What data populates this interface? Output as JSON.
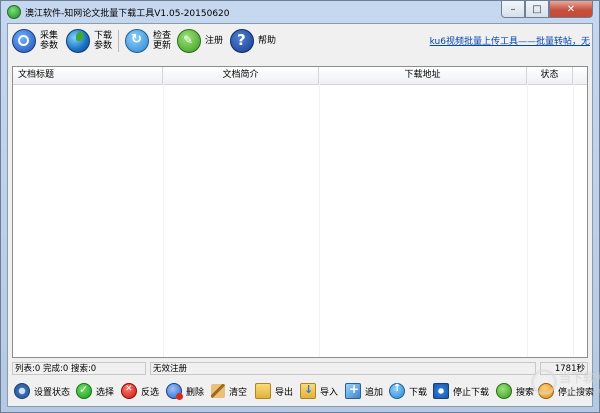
{
  "window": {
    "title": "澳江软件-知网论文批量下载工具V1.05-20150620",
    "controls": {
      "minimize": "–",
      "maximize": "□",
      "close": "✕"
    }
  },
  "toolbar": {
    "items": [
      {
        "name": "collect-params-button",
        "icon": "search-icon",
        "line1": "采集",
        "line2": "参数"
      },
      {
        "name": "download-params-button",
        "icon": "globe-icon",
        "line1": "下载",
        "line2": "参数"
      },
      {
        "name": "check-update-button",
        "icon": "refresh-icon",
        "line1": "检查",
        "line2": "更新"
      },
      {
        "name": "register-button",
        "icon": "register-icon",
        "line1": "注册",
        "line2": ""
      },
      {
        "name": "help-button",
        "icon": "help-icon",
        "line1": "帮助",
        "line2": ""
      }
    ],
    "link": "ku6视频批量上传工具——批量转帖，无"
  },
  "grid": {
    "columns": [
      "文档标题",
      "文档简介",
      "下载地址",
      "状态"
    ],
    "rows": []
  },
  "statusbar": {
    "counts": "列表:0 完成:0 搜索:0",
    "license": "无效注册",
    "timer": "1781秒"
  },
  "bottombar": {
    "items": [
      {
        "name": "settings-status-button",
        "icon": "gear-icon",
        "label": "设置状态"
      },
      {
        "name": "select-button",
        "icon": "check-icon",
        "label": "选择"
      },
      {
        "name": "invert-select-button",
        "icon": "x-icon",
        "label": "反选"
      },
      {
        "name": "delete-button",
        "icon": "delete-icon",
        "label": "删除"
      },
      {
        "name": "clear-button",
        "icon": "broom-icon",
        "label": "清空"
      },
      {
        "name": "export-button",
        "icon": "folder-icon",
        "label": "导出"
      },
      {
        "name": "import-button",
        "icon": "import-icon",
        "label": "导入"
      },
      {
        "name": "append-button",
        "icon": "add-icon",
        "label": "追加"
      },
      {
        "name": "download-button",
        "icon": "download-icon",
        "label": "下载"
      },
      {
        "name": "stop-download-button",
        "icon": "stop-icon",
        "label": "停止下载"
      },
      {
        "name": "search-button",
        "icon": "search-icon",
        "label": "搜索"
      },
      {
        "name": "stop-search-button",
        "icon": "stop-search-icon",
        "label": "停止搜索"
      }
    ]
  },
  "watermark": {
    "text1": "当下软件园",
    "text2": "www.downxia.com"
  }
}
